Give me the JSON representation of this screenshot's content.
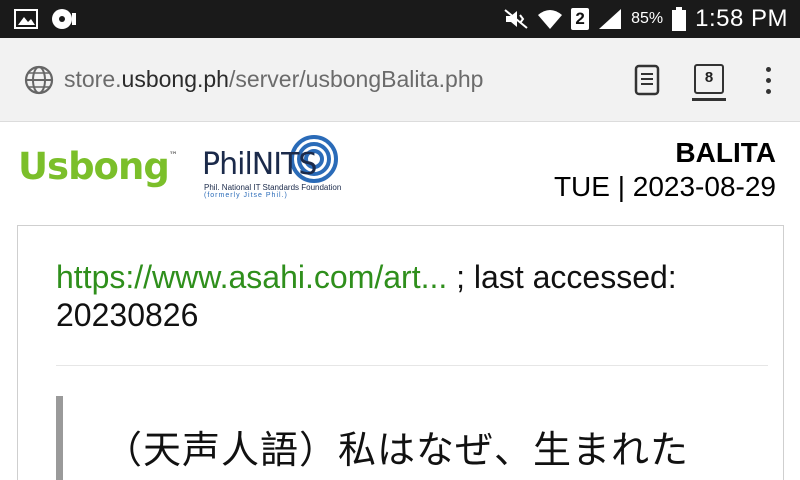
{
  "status_bar": {
    "time": "1:58 PM",
    "battery_percent": "85%",
    "sim_slot": "2",
    "icons": [
      "image-icon",
      "media-icon",
      "mute-icon",
      "wifi-icon",
      "signal-icon",
      "battery-icon"
    ]
  },
  "browser": {
    "url_prefix": "store.",
    "url_domain": "usbong.ph",
    "url_path": "/server/usbongBalita.php",
    "tab_count": "8"
  },
  "header": {
    "logo_usbong": "Usbong",
    "logo_usbong_tm": "™",
    "logo_philnits": "PhilNITS",
    "logo_philnits_sub1": "Phil. National IT Standards Foundation",
    "logo_philnits_sub2": "(formerly Jitse Phil.)",
    "title": "BALITA",
    "date": "TUE | 2023-08-29"
  },
  "article": {
    "source_link": "https://www.asahi.com/art...",
    "source_suffix": " ; last accessed: 20230826",
    "quote_title": "（天声人語）私はなぜ、生まれた"
  },
  "colors": {
    "status_bar_bg": "#1a1a1a",
    "usbong_green": "#7bbf2a",
    "link_green": "#2f8f1c",
    "philnits_blue": "#2a6bb8"
  }
}
